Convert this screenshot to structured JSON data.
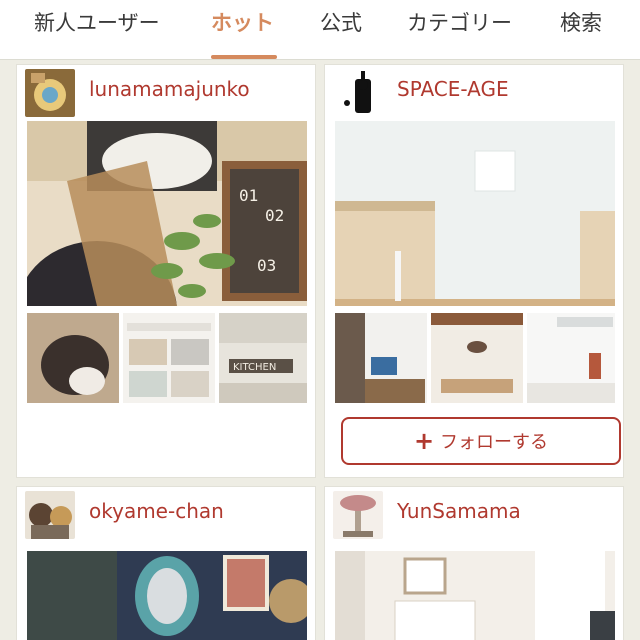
{
  "tabs": [
    {
      "label": "新人ユーザー",
      "active": false
    },
    {
      "label": "ホット",
      "active": true
    },
    {
      "label": "公式",
      "active": false
    },
    {
      "label": "カテゴリー",
      "active": false
    },
    {
      "label": "検索",
      "active": false
    }
  ],
  "cards": [
    {
      "username": "lunamamajunko"
    },
    {
      "username": "SPACE-AGE",
      "follow_label": "フォローする",
      "follow_icon": "plus-icon"
    },
    {
      "username": "okyame-chan"
    },
    {
      "username": "YunSamama"
    }
  ],
  "photo_texts": {
    "calendar_digits": [
      "01",
      "02",
      "03"
    ],
    "kitchen_sign": "KITCHEN"
  },
  "colors": {
    "accent": "#d58a5e",
    "username": "#b0392f",
    "background": "#eeede4"
  }
}
